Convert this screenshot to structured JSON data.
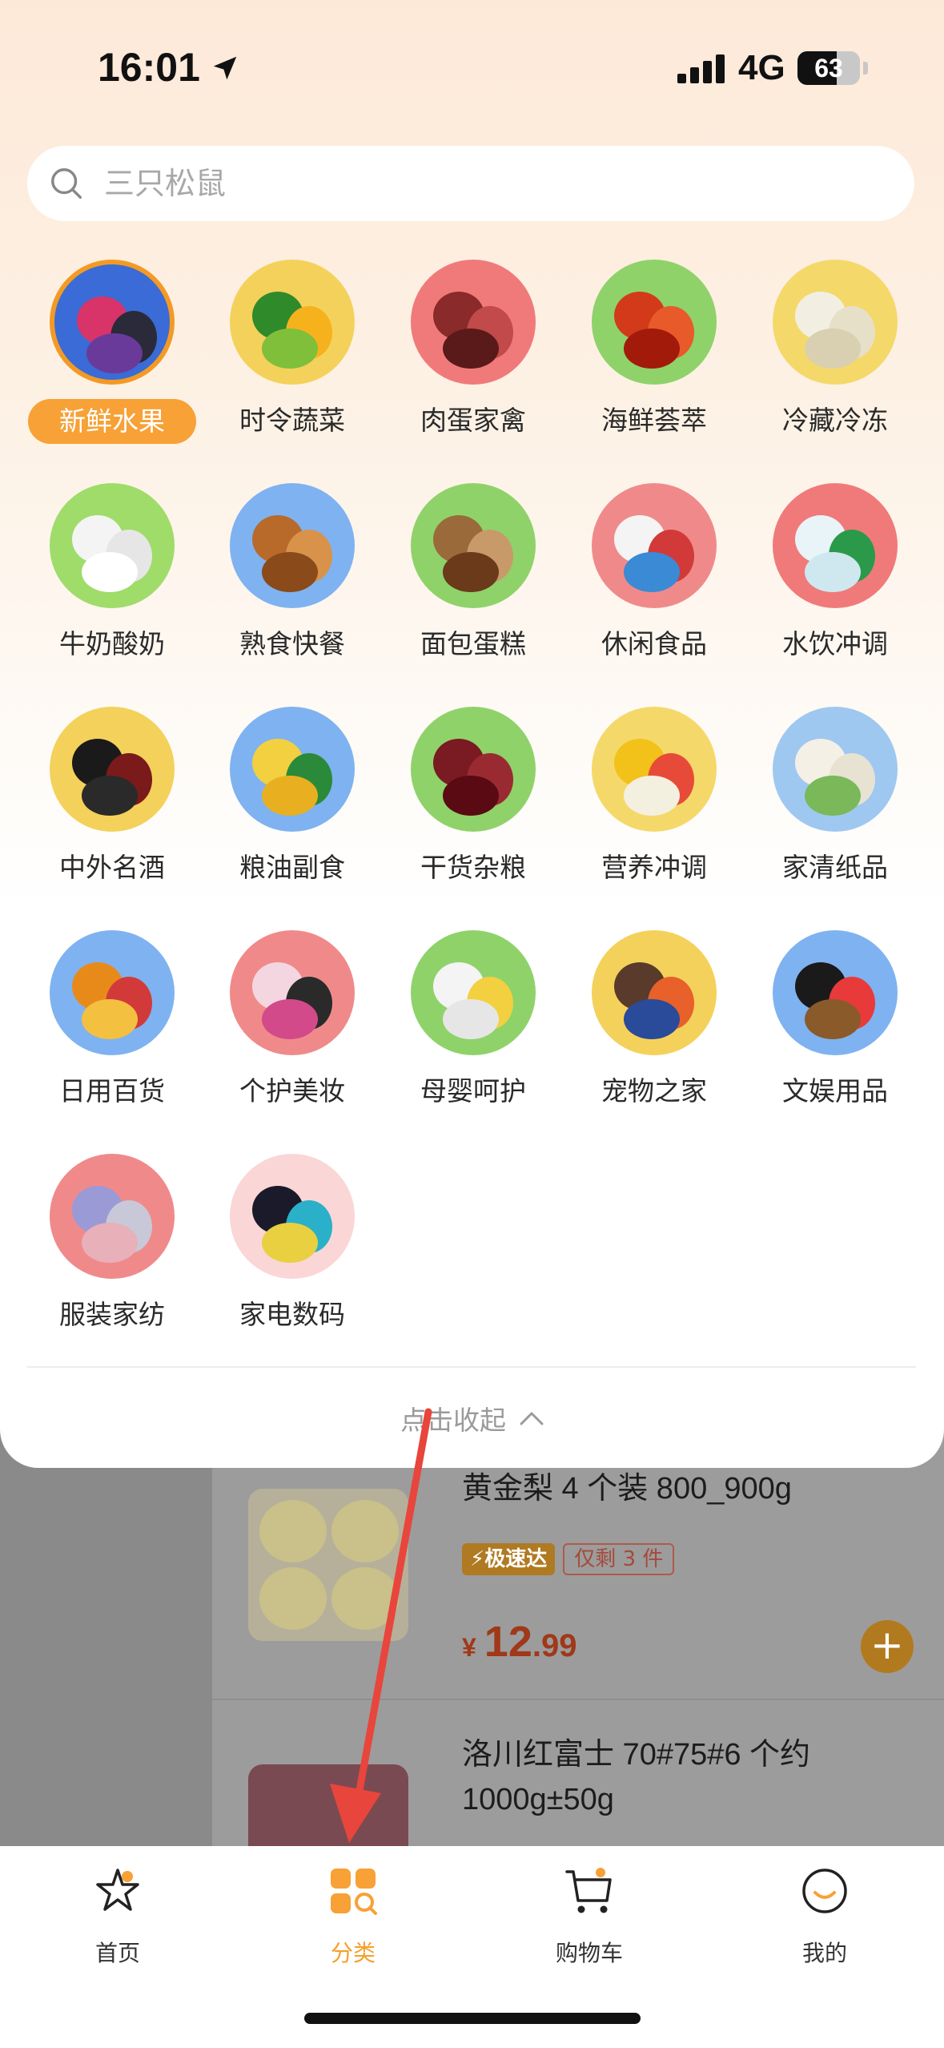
{
  "status": {
    "time": "16:01",
    "network": "4G",
    "battery": "63",
    "battery_level": 0.63
  },
  "search": {
    "placeholder": "三只松鼠"
  },
  "categories": [
    {
      "label": "新鲜水果",
      "icon": "fruit-icon",
      "active": true
    },
    {
      "label": "时令蔬菜",
      "icon": "vegetable-icon"
    },
    {
      "label": "肉蛋家禽",
      "icon": "meat-icon"
    },
    {
      "label": "海鲜荟萃",
      "icon": "seafood-icon"
    },
    {
      "label": "冷藏冷冻",
      "icon": "dumpling-icon"
    },
    {
      "label": "牛奶酸奶",
      "icon": "milk-icon"
    },
    {
      "label": "熟食快餐",
      "icon": "roast-chicken-icon"
    },
    {
      "label": "面包蛋糕",
      "icon": "bread-icon"
    },
    {
      "label": "休闲食品",
      "icon": "snack-icon"
    },
    {
      "label": "水饮冲调",
      "icon": "water-bottle-icon"
    },
    {
      "label": "中外名酒",
      "icon": "wine-icon"
    },
    {
      "label": "粮油副食",
      "icon": "oil-rice-icon"
    },
    {
      "label": "干货杂粮",
      "icon": "red-beans-icon"
    },
    {
      "label": "营养冲调",
      "icon": "wafer-icon"
    },
    {
      "label": "家清纸品",
      "icon": "tissue-icon"
    },
    {
      "label": "日用百货",
      "icon": "detergent-icon"
    },
    {
      "label": "个护美妆",
      "icon": "cosmetics-icon"
    },
    {
      "label": "母婴呵护",
      "icon": "baby-bottle-icon"
    },
    {
      "label": "宠物之家",
      "icon": "pet-food-icon"
    },
    {
      "label": "文娱用品",
      "icon": "ping-pong-icon"
    },
    {
      "label": "服装家纺",
      "icon": "towel-icon"
    },
    {
      "label": "家电数码",
      "icon": "tv-icon"
    }
  ],
  "collapse": {
    "label": "点击收起"
  },
  "products": [
    {
      "title": "黄金梨 4 个装 800_900g",
      "badge_fast": "⚡极速达",
      "badge_stock": "仅剩 3 件",
      "currency": "¥",
      "price_int": "12",
      "price_dec": ".99"
    },
    {
      "title": "洛川红富士 70#75#6 个约 1000g±50g"
    }
  ],
  "tabs": [
    {
      "label": "首页",
      "icon": "home-star-icon"
    },
    {
      "label": "分类",
      "icon": "category-grid-icon",
      "active": true
    },
    {
      "label": "购物车",
      "icon": "cart-icon"
    },
    {
      "label": "我的",
      "icon": "profile-icon"
    }
  ],
  "colors": {
    "accent": "#f39a25",
    "price": "#a0381a",
    "annotation": "#e8453c"
  }
}
